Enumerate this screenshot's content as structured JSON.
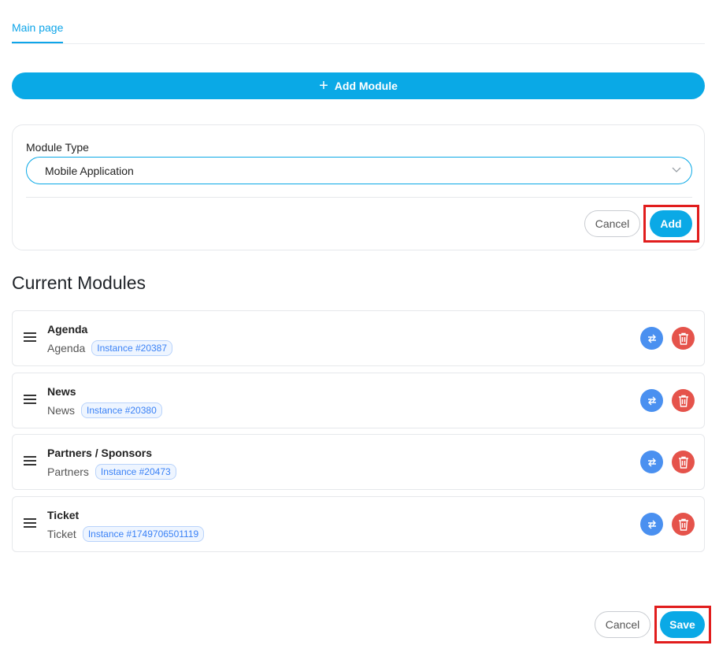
{
  "tabs": {
    "active": "Main page"
  },
  "add_module_button": {
    "label": "Add Module",
    "icon": "plus-icon"
  },
  "form": {
    "module_type_label": "Module Type",
    "module_type_value": "Mobile Application",
    "cancel_label": "Cancel",
    "add_label": "Add"
  },
  "current_modules": {
    "title": "Current Modules",
    "items": [
      {
        "title": "Agenda",
        "type": "Agenda",
        "instance": "Instance #20387"
      },
      {
        "title": "News",
        "type": "News",
        "instance": "Instance #20380"
      },
      {
        "title": "Partners / Sponsors",
        "type": "Partners",
        "instance": "Instance #20473"
      },
      {
        "title": "Ticket",
        "type": "Ticket",
        "instance": "Instance #1749706501119"
      }
    ]
  },
  "footer": {
    "cancel_label": "Cancel",
    "save_label": "Save"
  },
  "colors": {
    "accent": "#0aa9e6",
    "swap": "#4a90f0",
    "delete": "#e5534b",
    "highlight": "#e11d1d"
  },
  "icons": {
    "swap": "swap-icon",
    "delete": "trash-icon",
    "drag": "drag-handle-icon",
    "dropdown": "chevron-down-icon"
  }
}
